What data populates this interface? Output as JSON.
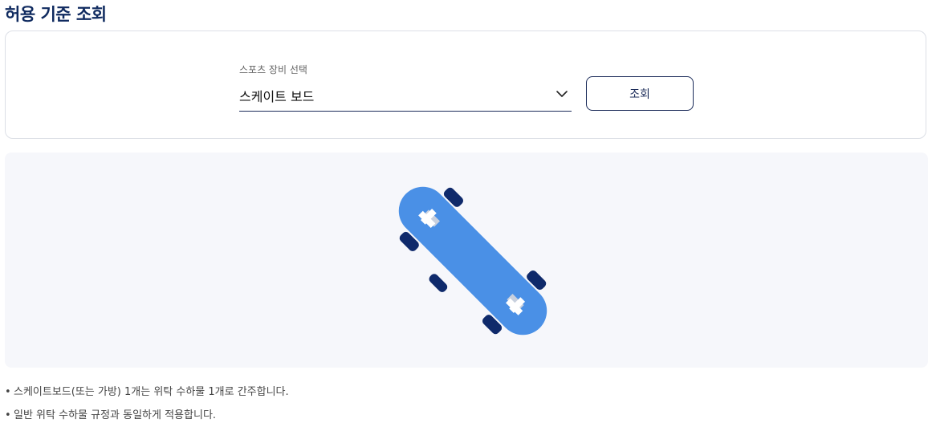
{
  "page": {
    "title": "허용 기준 조회"
  },
  "search": {
    "select_label": "스포츠 장비 선택",
    "selected_value": "스케이트 보드",
    "button_label": "조회"
  },
  "illustration": {
    "icon": "skateboard-icon",
    "colors": {
      "deck": "#4a90e6",
      "wheels": "#0f2a6b",
      "trucks": "#ffffff",
      "truck_shadow": "#c8d0de"
    }
  },
  "notes": {
    "bullet": "•",
    "items": [
      "스케이트보드(또는 가방) 1개는 위탁 수하물 1개로 간주합니다.",
      "일반 위탁 수하물 규정과 동일하게 적용합니다."
    ]
  },
  "colors": {
    "title": "#0f2a5f",
    "accent_border": "#1c2c5a",
    "panel_background": "#f6f7fb"
  }
}
